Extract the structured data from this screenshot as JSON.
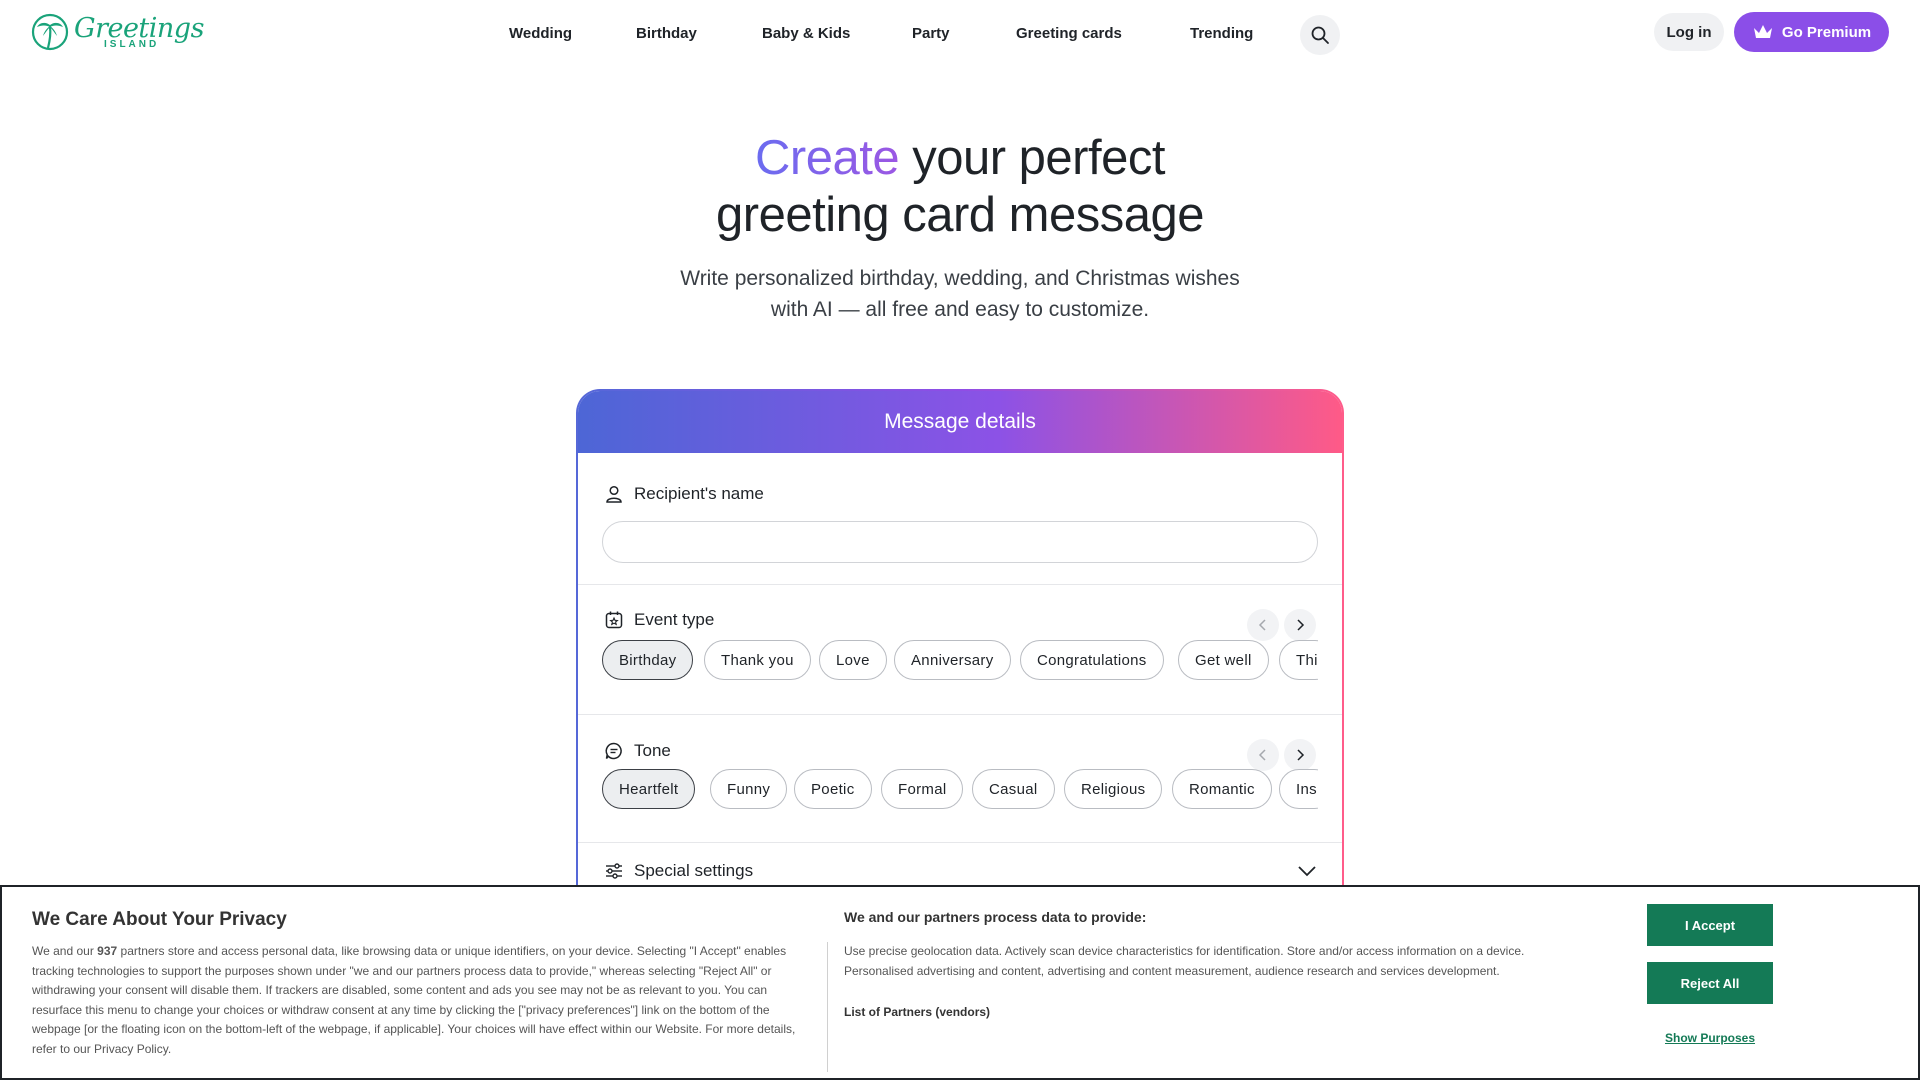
{
  "brand": {
    "name_word": "Greetings",
    "name_sub": "ISLAND",
    "color": "#1aa37a"
  },
  "nav": {
    "items": [
      {
        "label": "Wedding"
      },
      {
        "label": "Birthday"
      },
      {
        "label": "Baby & Kids"
      },
      {
        "label": "Party"
      },
      {
        "label": "Greeting cards"
      },
      {
        "label": "Trending"
      }
    ],
    "search_icon": "search-icon",
    "login_label": "Log in",
    "premium_label": "Go Premium",
    "premium_icon": "crown-icon",
    "premium_color": "#8b4ee8"
  },
  "hero": {
    "title_accent": "Create",
    "title_rest_line1": " your perfect",
    "title_line2": "greeting card message",
    "subtitle_line1": "Write personalized birthday, wedding, and Christmas wishes",
    "subtitle_line2": "with AI — all free and easy to customize."
  },
  "form": {
    "header": "Message details",
    "recipient": {
      "label": "Recipient's name",
      "icon": "person-icon",
      "value": "",
      "placeholder": ""
    },
    "event_type": {
      "label": "Event type",
      "icon": "calendar-star-icon",
      "options": [
        "Birthday",
        "Thank you",
        "Love",
        "Anniversary",
        "Congratulations",
        "Get well",
        "Thi"
      ],
      "selected": "Birthday"
    },
    "tone": {
      "label": "Tone",
      "icon": "chat-bubble-icon",
      "options": [
        "Heartfelt",
        "Funny",
        "Poetic",
        "Formal",
        "Casual",
        "Religious",
        "Romantic",
        "Ins"
      ],
      "selected": "Heartfelt"
    },
    "special_settings": {
      "label": "Special settings",
      "icon": "sliders-icon"
    }
  },
  "cookie_banner": {
    "title": "We Care About Your Privacy",
    "body_before_count": "We and our ",
    "partner_count": "937",
    "body_after_count": " partners store and access personal data, like browsing data or unique identifiers, on your device. Selecting \"I Accept\" enables tracking technologies to support the purposes shown under \"we and our partners process data to provide,\" whereas selecting \"Reject All\" or withdrawing your consent will disable them. If trackers are disabled, some content and ads you see may not be as relevant to you. You can resurface this menu to change your choices or withdraw consent at any time by clicking the [\"privacy preferences\"] link on the bottom of the webpage [or the floating icon on the bottom-left of the webpage, if applicable]. Your choices will have effect within our Website. For more details, refer to our Privacy Policy.",
    "purposes_title": "We and our partners process data to provide:",
    "purposes_text": "Use precise geolocation data. Actively scan device characteristics for identification. Store and/or access information on a device. Personalised advertising and content, advertising and content measurement, audience research and services development.",
    "partners_link": "List of Partners (vendors)",
    "accept_label": "I Accept",
    "reject_label": "Reject All",
    "show_purposes_label": "Show Purposes",
    "button_color": "#147a56"
  }
}
